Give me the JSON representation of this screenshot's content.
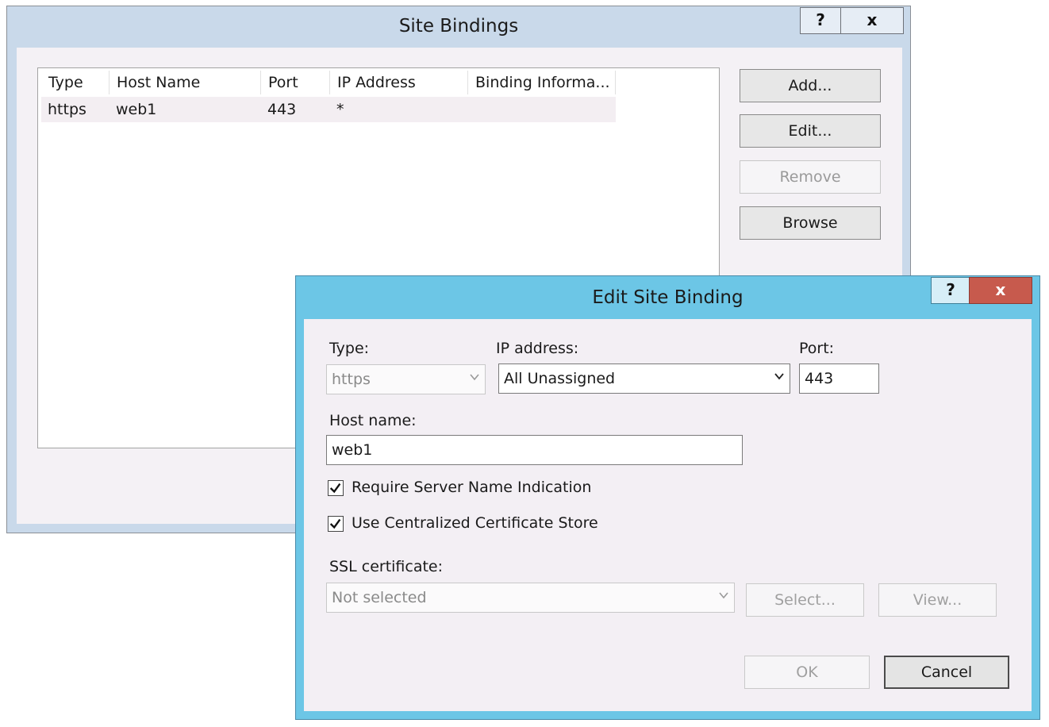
{
  "site_bindings": {
    "title": "Site Bindings",
    "help_label": "?",
    "close_label": "x",
    "columns": [
      "Type",
      "Host Name",
      "Port",
      "IP Address",
      "Binding Informa..."
    ],
    "rows": [
      {
        "type": "https",
        "host": "web1",
        "port": "443",
        "ip": "*",
        "binding": ""
      }
    ],
    "buttons": {
      "add": "Add...",
      "edit": "Edit...",
      "remove": "Remove",
      "browse": "Browse"
    }
  },
  "edit_binding": {
    "title": "Edit Site Binding",
    "help_label": "?",
    "close_label": "x",
    "type_label": "Type:",
    "type_value": "https",
    "ip_label": "IP address:",
    "ip_value": "All Unassigned",
    "port_label": "Port:",
    "port_value": "443",
    "host_label": "Host name:",
    "host_value": "web1",
    "sni_label": "Require Server Name Indication",
    "sni_checked": true,
    "ccs_label": "Use Centralized Certificate Store",
    "ccs_checked": true,
    "ssl_label": "SSL certificate:",
    "ssl_value": "Not selected",
    "select_label": "Select...",
    "view_label": "View...",
    "ok_label": "OK",
    "cancel_label": "Cancel"
  },
  "colors": {
    "dialog_frame": "#6cc6e6",
    "background_frame": "#c9d9ea",
    "close_button": "#c75a4d"
  }
}
